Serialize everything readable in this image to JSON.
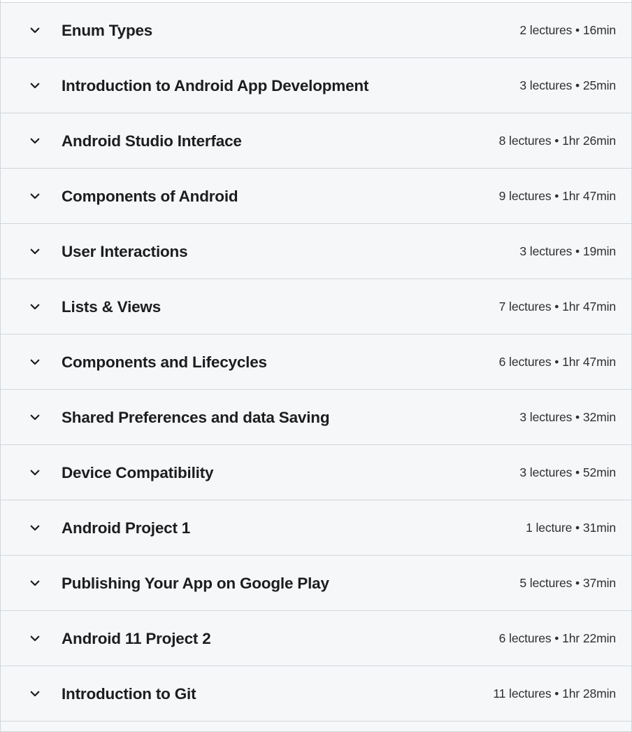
{
  "curriculum": {
    "icons": {
      "collapse_toggle": "chevron-down-icon"
    },
    "colors": {
      "row_background": "#f6f7f9",
      "border": "#d1d7dc",
      "title_text": "#1c1d1f",
      "meta_text": "#2d2f31"
    },
    "sections": [
      {
        "title": "Enum Types",
        "meta": "2 lectures • 16min",
        "lectures": 2,
        "duration": "16min",
        "expanded": false
      },
      {
        "title": "Introduction to Android App Development",
        "meta": "3 lectures • 25min",
        "lectures": 3,
        "duration": "25min",
        "expanded": false
      },
      {
        "title": "Android Studio Interface",
        "meta": "8 lectures • 1hr 26min",
        "lectures": 8,
        "duration": "1hr 26min",
        "expanded": false
      },
      {
        "title": "Components of Android",
        "meta": "9 lectures • 1hr 47min",
        "lectures": 9,
        "duration": "1hr 47min",
        "expanded": false
      },
      {
        "title": "User Interactions",
        "meta": "3 lectures • 19min",
        "lectures": 3,
        "duration": "19min",
        "expanded": false
      },
      {
        "title": "Lists & Views",
        "meta": "7 lectures • 1hr 47min",
        "lectures": 7,
        "duration": "1hr 47min",
        "expanded": false
      },
      {
        "title": "Components and Lifecycles",
        "meta": "6 lectures • 1hr 47min",
        "lectures": 6,
        "duration": "1hr 47min",
        "expanded": false
      },
      {
        "title": "Shared Preferences and data Saving",
        "meta": "3 lectures • 32min",
        "lectures": 3,
        "duration": "32min",
        "expanded": false
      },
      {
        "title": "Device Compatibility",
        "meta": "3 lectures • 52min",
        "lectures": 3,
        "duration": "52min",
        "expanded": false
      },
      {
        "title": "Android Project 1",
        "meta": "1 lecture • 31min",
        "lectures": 1,
        "duration": "31min",
        "expanded": false
      },
      {
        "title": "Publishing Your App on Google Play",
        "meta": "5 lectures • 37min",
        "lectures": 5,
        "duration": "37min",
        "expanded": false
      },
      {
        "title": "Android 11 Project 2",
        "meta": "6 lectures • 1hr 22min",
        "lectures": 6,
        "duration": "1hr 22min",
        "expanded": false
      },
      {
        "title": "Introduction to Git",
        "meta": "11 lectures • 1hr 28min",
        "lectures": 11,
        "duration": "1hr 28min",
        "expanded": false
      }
    ]
  }
}
